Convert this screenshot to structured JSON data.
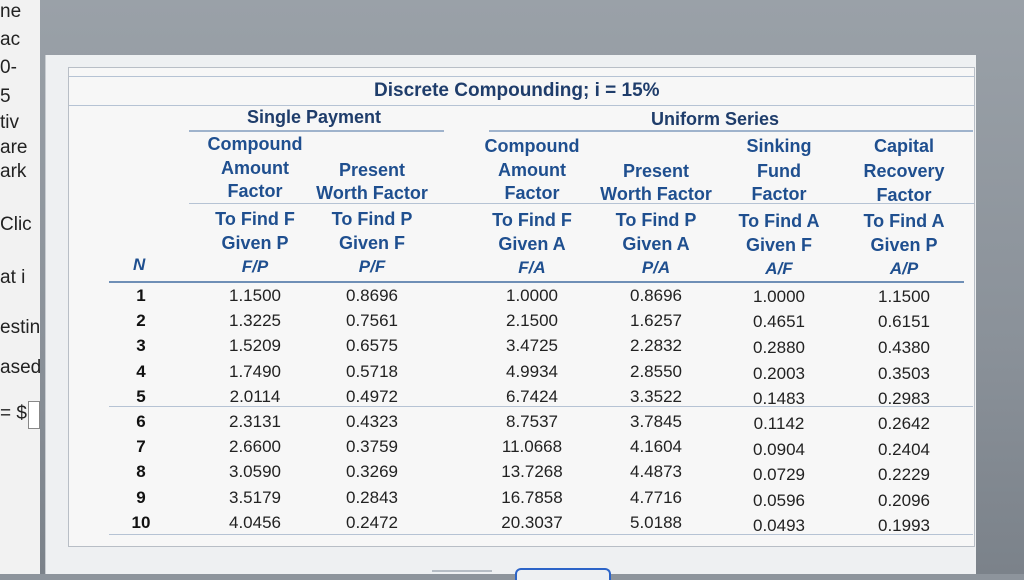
{
  "left_fragments": [
    "ne",
    "ac",
    "0-",
    "5",
    "tiv",
    "are",
    "ark",
    "Clic",
    "at i",
    "estin",
    "ased",
    "= $"
  ],
  "table": {
    "title": "Discrete Compounding; i = 15%",
    "groups": {
      "single": "Single Payment",
      "uniform": "Uniform Series"
    },
    "n_header": "N",
    "columns": [
      {
        "title": [
          "Compound",
          "Amount",
          "Factor"
        ],
        "find": "To Find F",
        "given": "Given P",
        "symbol": "F/P"
      },
      {
        "title": [
          "Present",
          "Worth Factor"
        ],
        "find": "To Find P",
        "given": "Given F",
        "symbol": "P/F"
      },
      {
        "title": [
          "Compound",
          "Amount",
          "Factor"
        ],
        "find": "To Find F",
        "given": "Given A",
        "symbol": "F/A"
      },
      {
        "title": [
          "Present",
          "Worth Factor"
        ],
        "find": "To Find P",
        "given": "Given A",
        "symbol": "P/A"
      },
      {
        "title": [
          "Sinking",
          "Fund",
          "Factor"
        ],
        "find": "To Find A",
        "given": "Given F",
        "symbol": "A/F"
      },
      {
        "title": [
          "Capital",
          "Recovery",
          "Factor"
        ],
        "find": "To Find A",
        "given": "Given P",
        "symbol": "A/P"
      }
    ],
    "rows": [
      {
        "n": "1",
        "values": [
          "1.1500",
          "0.8696",
          "1.0000",
          "0.8696",
          "1.0000",
          "1.1500"
        ]
      },
      {
        "n": "2",
        "values": [
          "1.3225",
          "0.7561",
          "2.1500",
          "1.6257",
          "0.4651",
          "0.6151"
        ]
      },
      {
        "n": "3",
        "values": [
          "1.5209",
          "0.6575",
          "3.4725",
          "2.2832",
          "0.2880",
          "0.4380"
        ]
      },
      {
        "n": "4",
        "values": [
          "1.7490",
          "0.5718",
          "4.9934",
          "2.8550",
          "0.2003",
          "0.3503"
        ]
      },
      {
        "n": "5",
        "values": [
          "2.0114",
          "0.4972",
          "6.7424",
          "3.3522",
          "0.1483",
          "0.2983"
        ]
      },
      {
        "n": "6",
        "values": [
          "2.3131",
          "0.4323",
          "8.7537",
          "3.7845",
          "0.1142",
          "0.2642"
        ]
      },
      {
        "n": "7",
        "values": [
          "2.6600",
          "0.3759",
          "11.0668",
          "4.1604",
          "0.0904",
          "0.2404"
        ]
      },
      {
        "n": "8",
        "values": [
          "3.0590",
          "0.3269",
          "13.7268",
          "4.4873",
          "0.0729",
          "0.2229"
        ]
      },
      {
        "n": "9",
        "values": [
          "3.5179",
          "0.2843",
          "16.7858",
          "4.7716",
          "0.0596",
          "0.2096"
        ]
      },
      {
        "n": "10",
        "values": [
          "4.0456",
          "0.2472",
          "20.3037",
          "5.0188",
          "0.0493",
          "0.1993"
        ]
      }
    ]
  }
}
